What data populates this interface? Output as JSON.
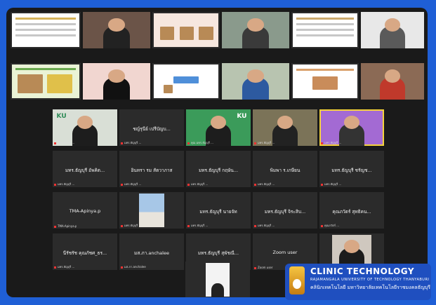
{
  "participants_row3": [
    {
      "name": "",
      "label": "มทร.ธัญบุรี ...",
      "style": "ku-person"
    },
    {
      "name": "ชญ์รุนีย์ เปรีบัญบ...",
      "label": "มทร.ธัญบุรี ..."
    },
    {
      "name": "",
      "label": "คุณ มทร.ธัญบุรี ...",
      "style": "ku-person"
    },
    {
      "name": "",
      "label": "มทร.ธัญบุรี ...",
      "style": "bookshelf-person"
    },
    {
      "name": "",
      "label": "มทร.ธัญบุรี ...",
      "style": "slide-person"
    }
  ],
  "participants_row4": [
    {
      "name": "มทร.ธัญบุรี อัพคิต...",
      "label": "มทร.ธัญบุรี ..."
    },
    {
      "name": "อินทรา รม สัตวาภาส",
      "label": "มทร.ธัญบุรี ..."
    },
    {
      "name": "มทร.ธัญบุรี กฤษัน...",
      "label": "มทร.ธัญบุรี ..."
    },
    {
      "name": "พิมพา ร.เกษียน",
      "label": "มทร.ธัญบุรี ..."
    },
    {
      "name": "มทร.ธัญบุรี ชรัญช...",
      "label": "มทร.ธัญบุรี ..."
    }
  ],
  "participants_row5": [
    {
      "name": "TMA-Apinya.p",
      "label": "TMA-Apinya.p"
    },
    {
      "name": "",
      "label": "มทร.ธัญบุรี ...",
      "style": "outdoor"
    },
    {
      "name": "มทร.ธัญบุรี นายจัท",
      "label": "มทร.ธัญบุรี ..."
    },
    {
      "name": "มทร.ธัญบุรี จิระสิบ...",
      "label": "มทร.ธัญบุรี ..."
    },
    {
      "name": "คุณภวัตร์ สุทธิคน...",
      "label": "คุณภวัตร์ ..."
    }
  ],
  "participants_row6": [
    {
      "name": "นีรัชรัช คุณภัชศ_ธร...",
      "label": "มทร.ธัญบุรี ..."
    },
    {
      "name": "มส.ภา.anchalee",
      "label": "มส.ภา.anchalee"
    },
    {
      "name": "มทร.ธัญบุรี สุพัชณี...",
      "label": "มทร.ธัญบุรี ..."
    },
    {
      "name": "Zoom user",
      "label": "Zoom user"
    },
    {
      "name": "",
      "label": "มทร.ธัญบุรี ...",
      "style": "masked-person"
    }
  ],
  "brand": {
    "title": "CLINIC TECHNOLOGY",
    "subtitle": "RAJAMANGALA UNIVERSITY OF TECHNOLOGY THANYABURI",
    "thai": "คลินิกเทคโนโลยี มหาวิทยาลัยเทคโนโลยีราชมงคลธัญบุรี"
  }
}
